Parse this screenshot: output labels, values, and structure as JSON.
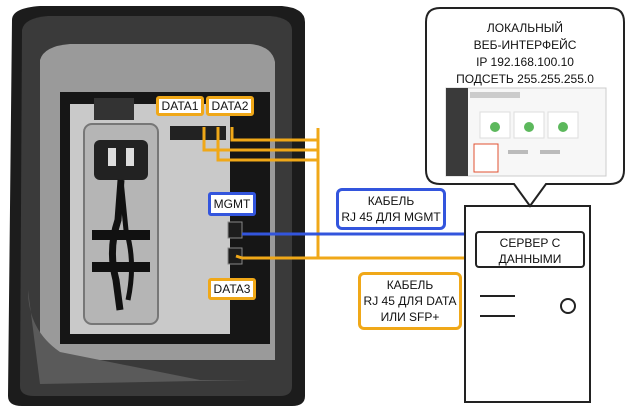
{
  "bubble": {
    "line1": "ЛОКАЛЬНЫЙ",
    "line2": "ВЕБ-ИНТЕРФЕЙС",
    "line3": "IP 192.168.100.10",
    "line4": "ПОДСЕТЬ 255.255.255.0"
  },
  "ports": {
    "data1": "DATA1",
    "data2": "DATA2",
    "mgmt": "MGMT",
    "data3": "DATA3"
  },
  "mgmt_cable": {
    "line1": "КАБЕЛЬ",
    "line2": "RJ 45 ДЛЯ MGMT"
  },
  "data_cable": {
    "line1": "КАБЕЛЬ",
    "line2": "RJ 45 ДЛЯ DATA",
    "line3": "ИЛИ SFP+"
  },
  "server": {
    "line1": "СЕРВЕР С",
    "line2": "ДАННЫМИ"
  },
  "colors": {
    "data": "#f0a818",
    "mgmt": "#3355dd"
  }
}
